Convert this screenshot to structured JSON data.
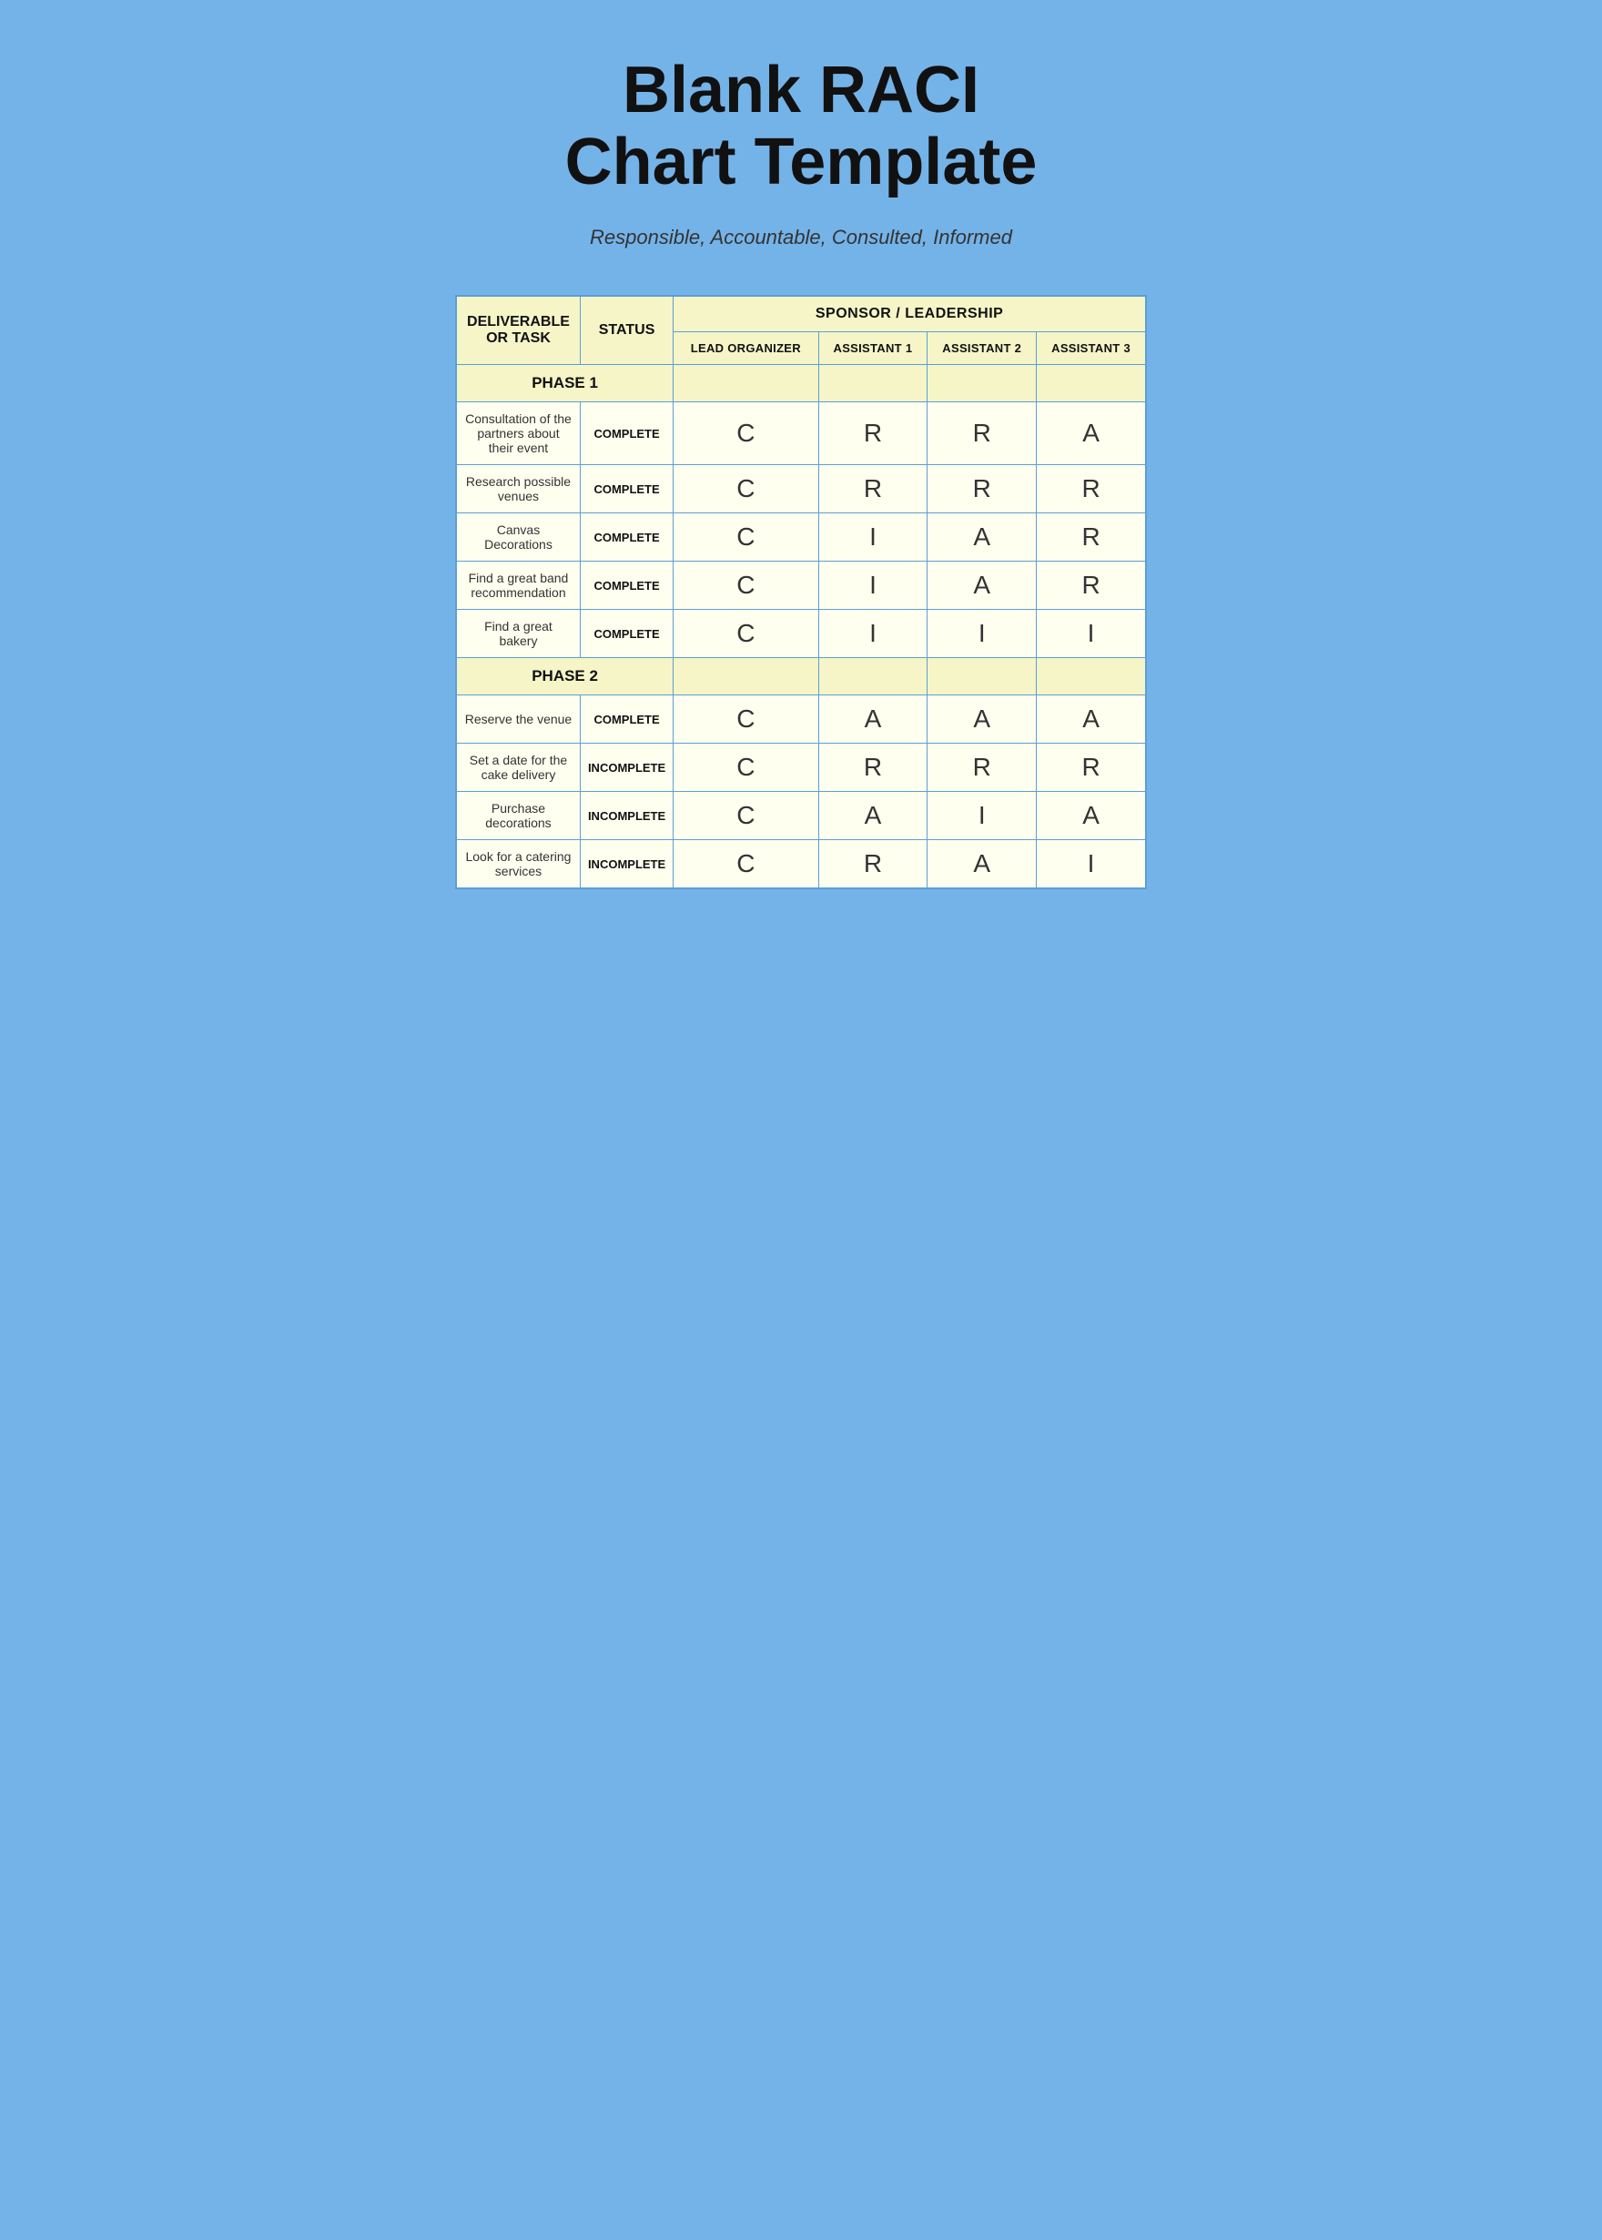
{
  "page": {
    "title_line1": "Blank RACI",
    "title_line2": "Chart Template",
    "subtitle": "Responsible, Accountable, Consulted, Informed"
  },
  "table": {
    "header1": {
      "deliverable": "DELIVERABLE OR TASK",
      "status": "STATUS",
      "sponsor": "SPONSOR / LEADERSHIP"
    },
    "header2": {
      "lead": "LEAD ORGANIZER",
      "assistant1": "ASSISTANT 1",
      "assistant2": "ASSISTANT 2",
      "assistant3": "ASSISTANT 3"
    },
    "phase1_label": "PHASE 1",
    "phase2_label": "PHASE 2",
    "rows": [
      {
        "task": "Consultation of the partners about their event",
        "status": "COMPLETE",
        "lead": "C",
        "a1": "R",
        "a2": "R",
        "a3": "A"
      },
      {
        "task": "Research possible venues",
        "status": "COMPLETE",
        "lead": "C",
        "a1": "R",
        "a2": "R",
        "a3": "R"
      },
      {
        "task": "Canvas Decorations",
        "status": "COMPLETE",
        "lead": "C",
        "a1": "I",
        "a2": "A",
        "a3": "R"
      },
      {
        "task": "Find a great band recommendation",
        "status": "COMPLETE",
        "lead": "C",
        "a1": "I",
        "a2": "A",
        "a3": "R"
      },
      {
        "task": "Find a great bakery",
        "status": "COMPLETE",
        "lead": "C",
        "a1": "I",
        "a2": "I",
        "a3": "I"
      },
      {
        "task": "Reserve the venue",
        "status": "COMPLETE",
        "lead": "C",
        "a1": "A",
        "a2": "A",
        "a3": "A"
      },
      {
        "task": "Set a date for the cake delivery",
        "status": "INCOMPLETE",
        "lead": "C",
        "a1": "R",
        "a2": "R",
        "a3": "R"
      },
      {
        "task": "Purchase decorations",
        "status": "INCOMPLETE",
        "lead": "C",
        "a1": "A",
        "a2": "I",
        "a3": "A"
      },
      {
        "task": "Look for a catering services",
        "status": "INCOMPLETE",
        "lead": "C",
        "a1": "R",
        "a2": "A",
        "a3": "I"
      }
    ]
  }
}
